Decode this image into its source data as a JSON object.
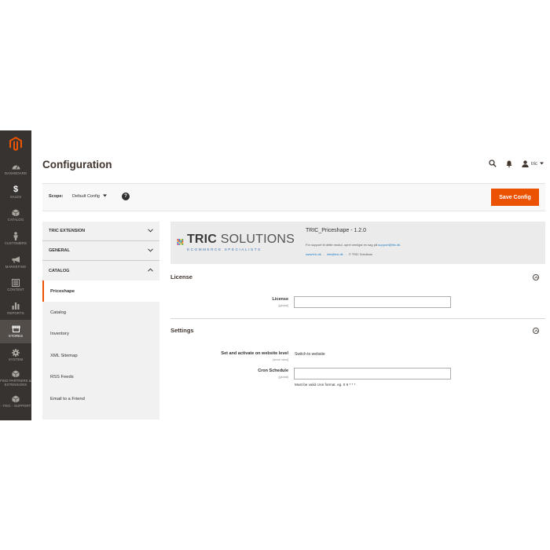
{
  "sidebar": {
    "items": [
      {
        "label": "Dashboard",
        "icon": "dashboard-icon"
      },
      {
        "label": "Sales",
        "icon": "dollar-icon"
      },
      {
        "label": "Catalog",
        "icon": "cube-icon"
      },
      {
        "label": "Customers",
        "icon": "person-icon"
      },
      {
        "label": "Marketing",
        "icon": "megaphone-icon"
      },
      {
        "label": "Content",
        "icon": "content-icon"
      },
      {
        "label": "Reports",
        "icon": "bar-chart-icon"
      },
      {
        "label": "Stores",
        "icon": "store-icon"
      },
      {
        "label": "System",
        "icon": "gear-icon"
      },
      {
        "label": "Find Partners & Extensions",
        "icon": "extensions-icon"
      },
      {
        "label": "- TRIC - Support",
        "icon": "support-icon"
      }
    ],
    "active_index": 7
  },
  "header": {
    "title": "Configuration",
    "user": "tric"
  },
  "scope": {
    "label": "Scope:",
    "value": "Default Config",
    "help": "?",
    "save_label": "Save Config"
  },
  "config_nav": {
    "sections": [
      {
        "title": "TRIC EXTENSION"
      },
      {
        "title": "GENERAL"
      },
      {
        "title": "CATALOG"
      }
    ],
    "catalog_items": [
      "Priceshape",
      "Catalog",
      "Inventory",
      "XML Sitemap",
      "RSS Feeds",
      "Email to a Friend"
    ]
  },
  "banner": {
    "brand_bold": "TRIC",
    "brand_rest": "SOLUTIONS",
    "tagline": "ECOMMERCE SPECIALISTS",
    "module_title": "TRIC_Priceshape - 1.2.0",
    "support_text": "For support til dette modul, opret venligst en sag på",
    "support_email": "support@tric.dk",
    "link_site": "www.tric.dk",
    "link_email": "info@tric.dk",
    "copyright": "© TRIC Solutions"
  },
  "license": {
    "title": "License",
    "field_label": "License",
    "field_scope": "[global]",
    "field_value": ""
  },
  "settings": {
    "title": "Settings",
    "activate_label": "Set and activate on website level",
    "activate_scope": "[store view]",
    "activate_value": "Switch to website",
    "cron_label": "Cron Schedule",
    "cron_scope": "[global]",
    "cron_value": "",
    "cron_note": "Must be valid cron format. eg. 0 6 * * *"
  },
  "colors": {
    "sidebar_bg": "#373330",
    "accent": "#eb5202",
    "link": "#1979c3"
  }
}
